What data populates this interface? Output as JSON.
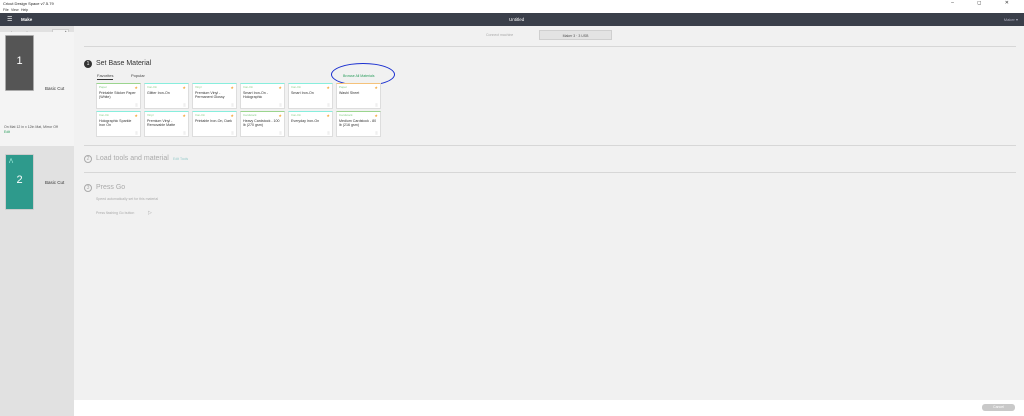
{
  "titlebar": {
    "title": "Cricut Design Space  v7.5.79",
    "controls": "–  ◻  ✕"
  },
  "menubar": [
    "File",
    "View",
    "Help"
  ],
  "header": {
    "make_label": "Make",
    "doc_title": "Untitled",
    "machine_label": "Maker ▾"
  },
  "sidebar": {
    "project_copies_label": "Project copies",
    "project_copies_value": "",
    "apply_label": "Apply",
    "mats": [
      {
        "number": "1",
        "label": "Basic Cut"
      },
      {
        "number": "2",
        "label": "Basic Cut"
      }
    ],
    "mat_info": "On Mat 12 in x 12in Mat, Mirror Off",
    "edit_label": "Edit"
  },
  "connection": {
    "label": "Connect machine",
    "button": "Maker 3 · 3 USB"
  },
  "steps": [
    {
      "number": "1",
      "title": "Set Base Material"
    },
    {
      "number": "2",
      "title": "Load tools and material",
      "sub": "Edit Tools"
    },
    {
      "number": "3",
      "title": "Press Go",
      "sub1": "Speed automatically set for this material",
      "sub2": "Press flashing Go button"
    }
  ],
  "tabs": [
    "Favorites",
    "Popular"
  ],
  "browse_all": "Browse All Materials",
  "material_cards": [
    {
      "category": "Paper",
      "name": "Printable Sticker Paper (White)",
      "border": "green"
    },
    {
      "category": "Iron-On",
      "name": "Glitter Iron-On",
      "border": "teal"
    },
    {
      "category": "Vinyl",
      "name": "Premium Vinyl - Permanent Glossy",
      "border": "teal"
    },
    {
      "category": "Iron-On",
      "name": "Smart Iron-On - Holographic",
      "border": "teal"
    },
    {
      "category": "Iron-On",
      "name": "Smart Iron-On",
      "border": "teal"
    },
    {
      "category": "Paper",
      "name": "Washi Sheet",
      "border": "orange"
    },
    {
      "category": "Iron-On",
      "name": "Holographic Sparkle Iron On",
      "border": "teal"
    },
    {
      "category": "Vinyl",
      "name": "Premium Vinyl - Removable Matte",
      "border": "teal"
    },
    {
      "category": "Iron-On",
      "name": "Printable Iron-On, Dark",
      "border": "teal"
    },
    {
      "category": "Cardstock",
      "name": "Heavy Cardstock - 100 lb (270 gsm)",
      "border": "green"
    },
    {
      "category": "Iron-On",
      "name": "Everyday Iron-On",
      "border": "teal"
    },
    {
      "category": "Cardstock",
      "name": "Medium Cardstock - 80 lb (216 gsm)",
      "border": "green"
    }
  ],
  "footer": {
    "cancel_label": "Cancel"
  },
  "colors": {
    "accent_green": "#2a9d5c",
    "header_bg": "#3a3f4a",
    "annotation_blue": "#1a2fd0"
  }
}
